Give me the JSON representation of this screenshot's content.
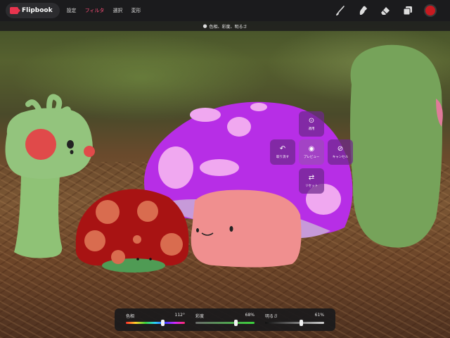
{
  "app": {
    "name": "Flipbook",
    "menu": [
      "設定",
      "フィルタ",
      "選択",
      "変形"
    ],
    "active_menu_index": 1
  },
  "toolbar": {
    "tools": [
      "brush-icon",
      "smudge-icon",
      "eraser-icon",
      "layers-icon",
      "color-swatch-icon"
    ],
    "current_color": "#c81a20"
  },
  "filter": {
    "title": "色相、彩度、明るさ",
    "title_icon": "adjustment-icon"
  },
  "radial_menu": {
    "apply": {
      "label": "適用",
      "icon": "check-circle-icon"
    },
    "undo": {
      "label": "取り消す",
      "icon": "undo-icon"
    },
    "preview": {
      "label": "プレビュー",
      "icon": "eye-icon",
      "active": true
    },
    "cancel": {
      "label": "キャンセル",
      "icon": "cancel-icon"
    },
    "reset": {
      "label": "リセット",
      "icon": "reset-icon"
    }
  },
  "sliders": [
    {
      "label": "色相",
      "value": "112°",
      "fraction": 0.62
    },
    {
      "label": "彩度",
      "value": "68%",
      "fraction": 0.68
    },
    {
      "label": "明るさ",
      "value": "61%",
      "fraction": 0.61
    }
  ],
  "colors": {
    "accent": "#ff4f79",
    "purple_mushroom": "#b72ee6",
    "red_mushroom": "#a81313",
    "green_character": "#8fc276",
    "pink_blob": "#f08f8f"
  }
}
